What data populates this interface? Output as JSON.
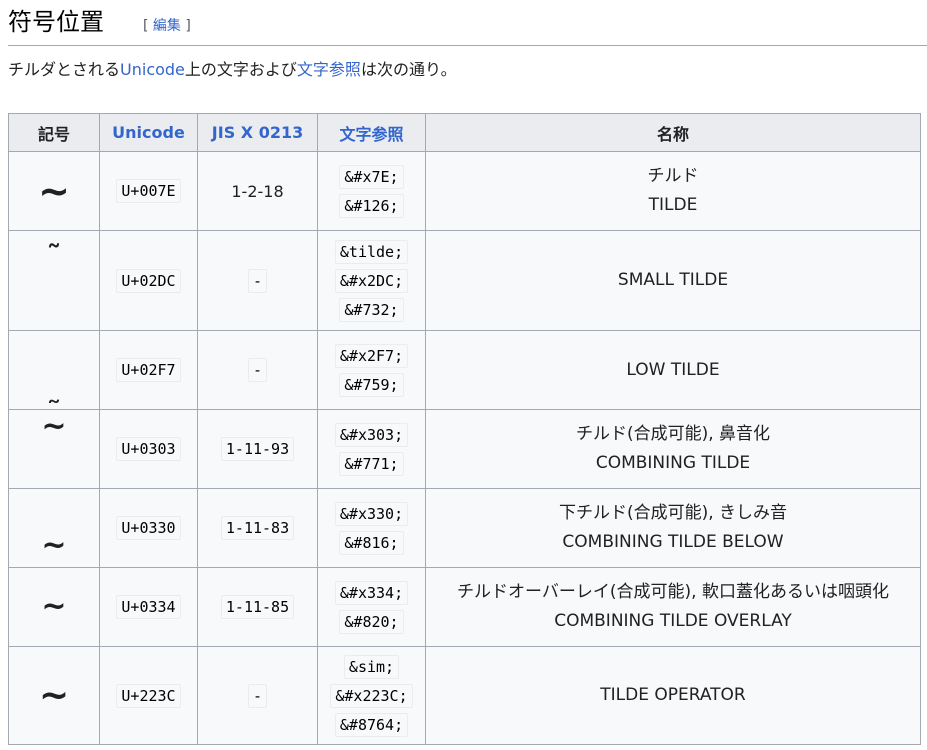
{
  "heading": {
    "title": "符号位置",
    "edit_open": "[ ",
    "edit_label": "編集",
    "edit_close": " ]"
  },
  "intro": {
    "prefix": "チルダとされる",
    "link1": "Unicode",
    "middle": "上の文字および",
    "link2": "文字参照",
    "suffix": "は次の通り。"
  },
  "table": {
    "headers": [
      "記号",
      "Unicode",
      "JIS X 0213",
      "文字参照",
      "名称"
    ],
    "rows": [
      {
        "symbol": "~",
        "unicode": "U+007E",
        "jis": "1-2-18",
        "refs": [
          "&#x7E;",
          "&#126;"
        ],
        "names": [
          "チルド",
          "TILDE"
        ]
      },
      {
        "symbol": "˜",
        "unicode": "U+02DC",
        "jis": "-",
        "refs": [
          "&tilde;",
          "&#x2DC;",
          "&#732;"
        ],
        "names": [
          "SMALL TILDE"
        ]
      },
      {
        "symbol": "˷",
        "unicode": "U+02F7",
        "jis": "-",
        "refs": [
          "&#x2F7;",
          "&#759;"
        ],
        "names": [
          "LOW TILDE"
        ]
      },
      {
        "symbol": "~",
        "unicode": "U+0303",
        "jis": "1-11-93",
        "refs": [
          "&#x303;",
          "&#771;"
        ],
        "names": [
          "チルド(合成可能), 鼻音化",
          "COMBINING TILDE"
        ]
      },
      {
        "symbol": "~",
        "unicode": "U+0330",
        "jis": "1-11-83",
        "refs": [
          "&#x330;",
          "&#816;"
        ],
        "names": [
          "下チルド(合成可能), きしみ音",
          "COMBINING TILDE BELOW"
        ]
      },
      {
        "symbol": "~",
        "unicode": "U+0334",
        "jis": "1-11-85",
        "refs": [
          "&#x334;",
          "&#820;"
        ],
        "names": [
          "チルドオーバーレイ(合成可能), 軟口蓋化あるいは咽頭化",
          "COMBINING TILDE OVERLAY"
        ]
      },
      {
        "symbol": "∼",
        "unicode": "U+223C",
        "jis": "-",
        "refs": [
          "&sim;",
          "&#x223C;",
          "&#8764;"
        ],
        "names": [
          "TILDE OPERATOR"
        ]
      }
    ]
  }
}
